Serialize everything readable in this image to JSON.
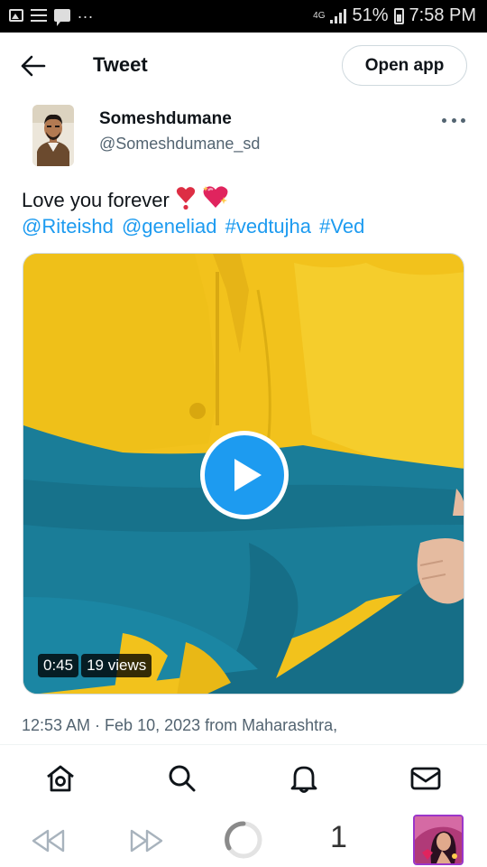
{
  "status_bar": {
    "network": "4G",
    "battery": "51%",
    "time": "7:58 PM",
    "more": "..."
  },
  "header": {
    "title": "Tweet",
    "open_app_label": "Open app"
  },
  "author": {
    "name": "Someshdumane",
    "handle": "@Someshdumane_sd"
  },
  "tweet": {
    "text": "Love you forever",
    "mentions": [
      "@Riteishd",
      "@geneliad",
      "#vedtujha",
      "#Ved"
    ]
  },
  "video": {
    "duration": "0:45",
    "views": "19 views"
  },
  "timestamp": "12:53 AM · Feb 10, 2023 from Maharashtra,",
  "browser": {
    "tab_count": "1"
  },
  "colors": {
    "accent": "#1d9bf0",
    "text": "#0f1419",
    "muted": "#536471",
    "tab_border": "#9b36c9"
  }
}
